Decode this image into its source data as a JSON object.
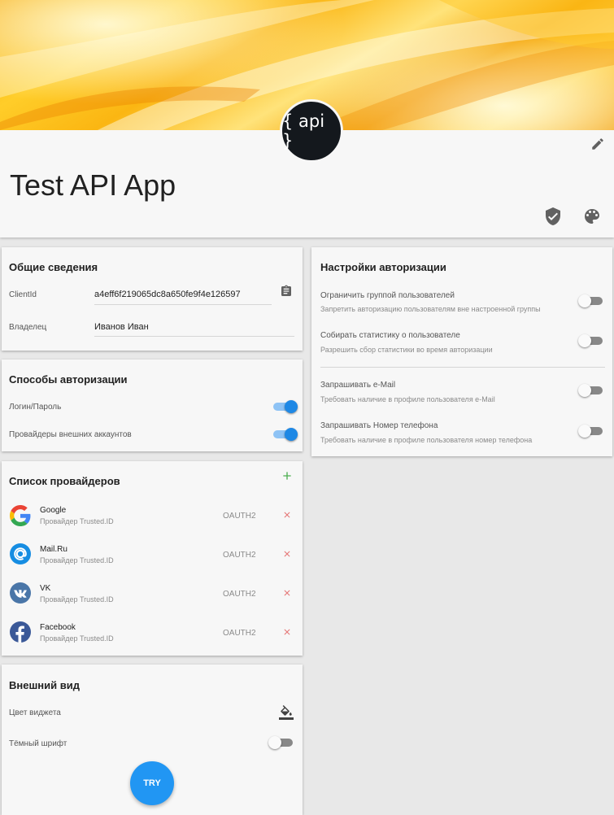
{
  "header": {
    "logo_text": "{ api }",
    "app_title": "Test API App"
  },
  "general": {
    "title": "Общие сведения",
    "client_id_label": "ClientId",
    "client_id_value": "a4eff6f219065dc8a650fe9f4e126597",
    "owner_label": "Владелец",
    "owner_value": "Иванов Иван"
  },
  "auth_methods": {
    "title": "Способы авторизации",
    "items": [
      {
        "label": "Логин/Пароль",
        "enabled": true
      },
      {
        "label": "Провайдеры внешних аккаунтов",
        "enabled": true
      }
    ]
  },
  "providers": {
    "title": "Список провайдеров",
    "items": [
      {
        "name": "Google",
        "subtitle": "Провайдер Trusted.ID",
        "type": "OAUTH2",
        "icon": "google-icon"
      },
      {
        "name": "Mail.Ru",
        "subtitle": "Провайдер Trusted.ID",
        "type": "OAUTH2",
        "icon": "mailru-icon"
      },
      {
        "name": "VK",
        "subtitle": "Провайдер Trusted.ID",
        "type": "OAUTH2",
        "icon": "vk-icon"
      },
      {
        "name": "Facebook",
        "subtitle": "Провайдер Trusted.ID",
        "type": "OAUTH2",
        "icon": "facebook-icon"
      }
    ]
  },
  "appearance": {
    "title": "Внешний вид",
    "widget_color_label": "Цвет виджета",
    "dark_font_label": "Тёмный шрифт",
    "dark_font_enabled": false,
    "try_label": "TRY"
  },
  "auth_settings": {
    "title": "Настройки авторизации",
    "items": [
      {
        "label": "Ограничить группой пользователей",
        "hint": "Запретить авторизацию пользователям вне настроенной группы",
        "enabled": false
      },
      {
        "label": "Собирать статистику о пользователе",
        "hint": "Разрешить сбор статистики во время авторизации",
        "enabled": false
      },
      {
        "label": "Запрашивать e-Mail",
        "hint": "Требовать наличие в профиле пользователя e-Mail",
        "enabled": false
      },
      {
        "label": "Запрашивать Номер телефона",
        "hint": "Требовать наличие в профиле пользователя номер телефона",
        "enabled": false
      }
    ]
  },
  "colors": {
    "accent": "#1e88e5",
    "add": "#4caf50",
    "delete": "#e57373",
    "try_button": "#2196f3"
  }
}
